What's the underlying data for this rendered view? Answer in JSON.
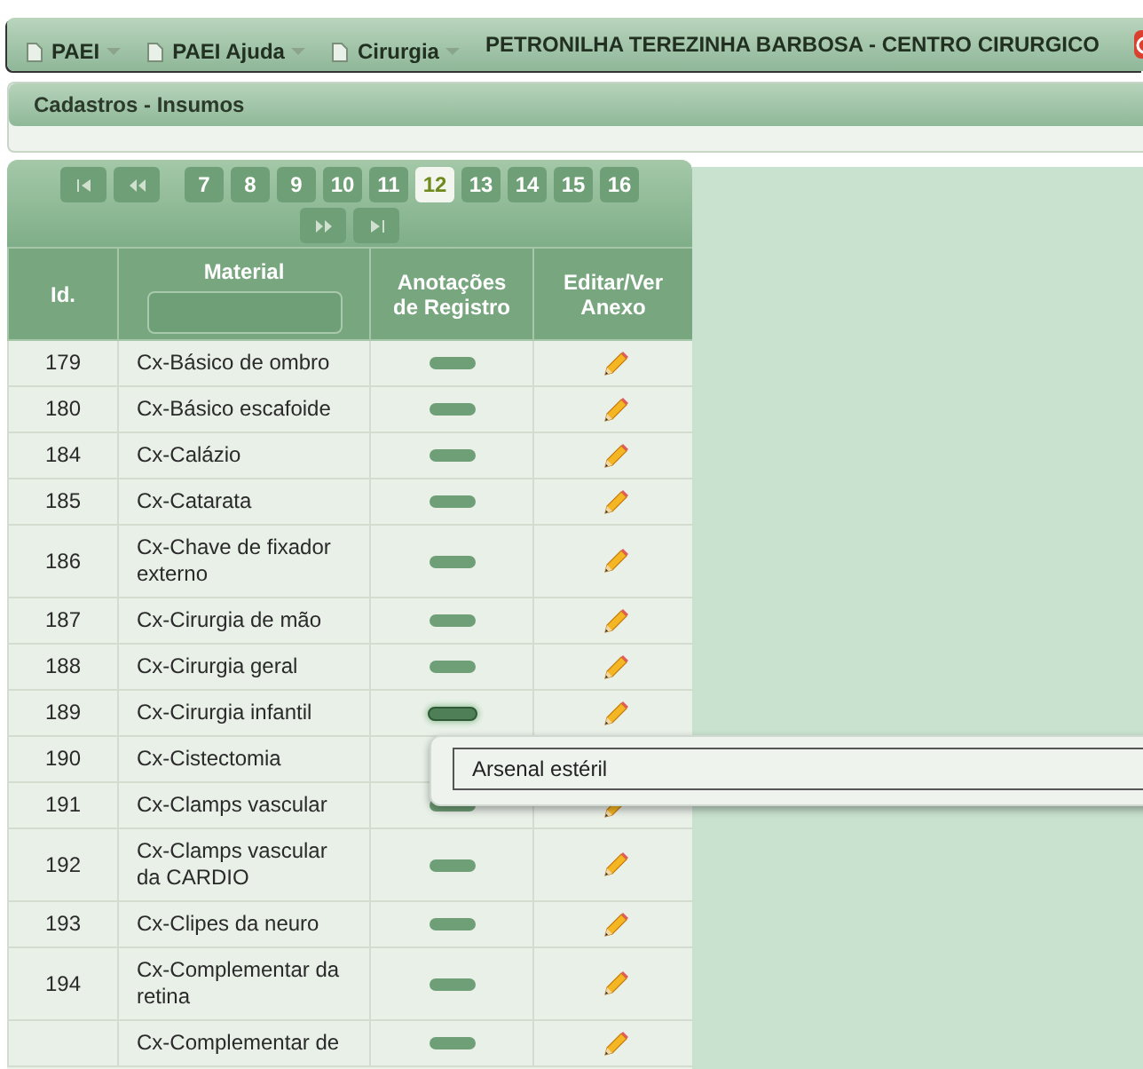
{
  "menu": [
    {
      "label": "PAEI"
    },
    {
      "label": "PAEI Ajuda"
    },
    {
      "label": "Cirurgia"
    }
  ],
  "user": "PETRONILHA TEREZINHA BARBOSA - CENTRO CIRURGICO",
  "breadcrumb": "Cadastros - Insumos",
  "pagination": {
    "pages": [
      {
        "label": "7",
        "selected": false
      },
      {
        "label": "8",
        "selected": false
      },
      {
        "label": "9",
        "selected": false
      },
      {
        "label": "10",
        "selected": false
      },
      {
        "label": "11",
        "selected": false
      },
      {
        "label": "12",
        "selected": true
      },
      {
        "label": "13",
        "selected": false
      },
      {
        "label": "14",
        "selected": false
      },
      {
        "label": "15",
        "selected": false
      },
      {
        "label": "16",
        "selected": false
      }
    ]
  },
  "table": {
    "columns": [
      "Id.",
      "Material",
      "Anotações de Registro",
      "Editar/Ver Anexo"
    ],
    "rows": [
      {
        "id": "179",
        "material": "Cx-Básico de ombro",
        "hovered": false
      },
      {
        "id": "180",
        "material": "Cx-Básico escafoide",
        "hovered": false
      },
      {
        "id": "184",
        "material": "Cx-Calázio",
        "hovered": false
      },
      {
        "id": "185",
        "material": "Cx-Catarata",
        "hovered": false
      },
      {
        "id": "186",
        "material": "Cx-Chave de fixador externo",
        "hovered": false
      },
      {
        "id": "187",
        "material": "Cx-Cirurgia de mão",
        "hovered": false
      },
      {
        "id": "188",
        "material": "Cx-Cirurgia geral",
        "hovered": false
      },
      {
        "id": "189",
        "material": "Cx-Cirurgia infantil",
        "hovered": true
      },
      {
        "id": "190",
        "material": "Cx-Cistectomia"
      },
      {
        "id": "191",
        "material": "Cx-Clamps vascular",
        "hovered": false
      },
      {
        "id": "192",
        "material": "Cx-Clamps vascular da CARDIO",
        "hovered": false
      },
      {
        "id": "193",
        "material": "Cx-Clipes da neuro",
        "hovered": false
      },
      {
        "id": "194",
        "material": "Cx-Complementar da retina",
        "hovered": false
      },
      {
        "material": "Cx-Complementar de",
        "hovered": false
      }
    ]
  },
  "tooltip": {
    "text": "Arsenal estéril"
  }
}
